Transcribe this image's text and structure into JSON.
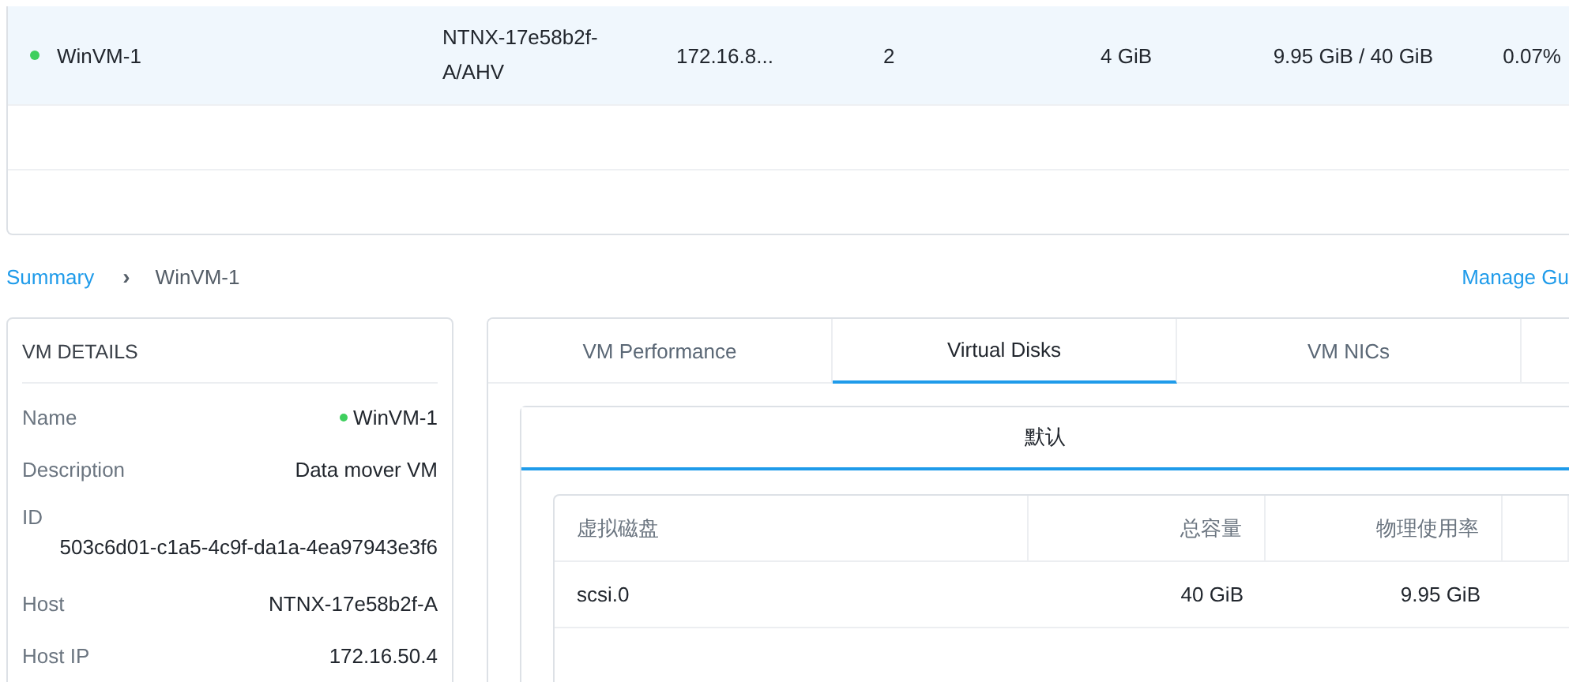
{
  "vm_table": {
    "rows": [
      {
        "selected": true,
        "color": "#3ecf5e",
        "name": "WinVM-1",
        "host": "NTNX-17e58b2f-A/AHV",
        "ip": "172.16.8...",
        "vcpus": "2",
        "memory": "4 GiB",
        "storage": "9.95 GiB / 40 GiB",
        "usage": "0.07%"
      }
    ]
  },
  "breadcrumb": {
    "link": "Summary",
    "separator": "›",
    "current": "WinVM-1"
  },
  "manage_link": "Manage Gu",
  "vm_details": {
    "title": "VM DETAILS",
    "fields": [
      {
        "label": "Name",
        "value": "WinVM-1",
        "color": "#3ecf5e",
        "kind": "status"
      },
      {
        "label": "Description",
        "value": "Data mover VM",
        "kind": "inline"
      },
      {
        "label": "ID",
        "value": "503c6d01-c1a5-4c9f-da1a-4ea97943e3f6",
        "kind": "stacked"
      },
      {
        "label": "Host",
        "value": "NTNX-17e58b2f-A",
        "kind": "inline"
      },
      {
        "label": "Host IP",
        "value": "172.16.50.4",
        "kind": "inline"
      }
    ]
  },
  "tabs": [
    {
      "label": "VM Performance",
      "selected": false
    },
    {
      "label": "Virtual Disks",
      "selected": true
    },
    {
      "label": "VM NICs",
      "selected": false
    }
  ],
  "subtabs": [
    {
      "label": "默认",
      "selected": true
    }
  ],
  "disk_table": {
    "columns": [
      "虚拟磁盘",
      "总容量",
      "物理使用率"
    ],
    "rows": [
      [
        "scsi.0",
        "40 GiB",
        "9.95 GiB"
      ]
    ]
  }
}
